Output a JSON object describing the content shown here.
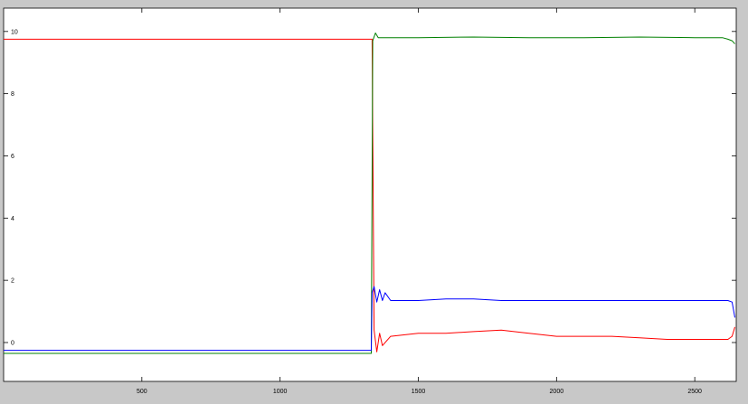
{
  "chart_data": {
    "type": "line",
    "title": "",
    "xlabel": "",
    "ylabel": "",
    "xlim": [
      0,
      2650
    ],
    "ylim": [
      -1.25,
      10.75
    ],
    "xticks": [
      500,
      1000,
      1500,
      2000,
      2500
    ],
    "yticks": [
      0,
      2,
      4,
      6,
      8,
      10
    ],
    "xtick_labels": [
      "500",
      "1000",
      "1500",
      "2000",
      "2500"
    ],
    "ytick_labels": [
      "0",
      "2",
      "4",
      "6",
      "8",
      "10"
    ],
    "grid": false,
    "legend": "none",
    "series": [
      {
        "color": "#ff0000",
        "x": [
          0,
          500,
          1000,
          1330,
          1333,
          1340,
          1350,
          1360,
          1370,
          1400,
          1500,
          1600,
          1700,
          1800,
          1900,
          2000,
          2100,
          2200,
          2300,
          2400,
          2500,
          2600,
          2620,
          2635,
          2645
        ],
        "values": [
          9.75,
          9.75,
          9.75,
          9.75,
          9.75,
          0.4,
          -0.3,
          0.3,
          -0.1,
          0.2,
          0.3,
          0.3,
          0.35,
          0.4,
          0.3,
          0.2,
          0.2,
          0.2,
          0.15,
          0.1,
          0.1,
          0.1,
          0.1,
          0.2,
          0.5
        ]
      },
      {
        "color": "#008000",
        "x": [
          0,
          500,
          1000,
          1330,
          1335,
          1345,
          1355,
          1365,
          1380,
          1500,
          1700,
          1900,
          2100,
          2300,
          2500,
          2600,
          2620,
          2635,
          2645
        ],
        "values": [
          -0.35,
          -0.35,
          -0.35,
          -0.35,
          9.7,
          9.95,
          9.8,
          9.8,
          9.8,
          9.8,
          9.82,
          9.8,
          9.8,
          9.82,
          9.8,
          9.8,
          9.75,
          9.7,
          9.6
        ]
      },
      {
        "color": "#0000ff",
        "x": [
          0,
          500,
          1000,
          1330,
          1333,
          1340,
          1350,
          1360,
          1370,
          1380,
          1400,
          1500,
          1600,
          1700,
          1800,
          1900,
          2000,
          2100,
          2200,
          2300,
          2400,
          2500,
          2600,
          2620,
          2635,
          2645
        ],
        "values": [
          -0.25,
          -0.25,
          -0.25,
          -0.25,
          1.6,
          1.8,
          1.3,
          1.7,
          1.35,
          1.6,
          1.35,
          1.35,
          1.4,
          1.4,
          1.35,
          1.35,
          1.35,
          1.35,
          1.35,
          1.35,
          1.35,
          1.35,
          1.35,
          1.35,
          1.3,
          0.8
        ]
      }
    ]
  }
}
